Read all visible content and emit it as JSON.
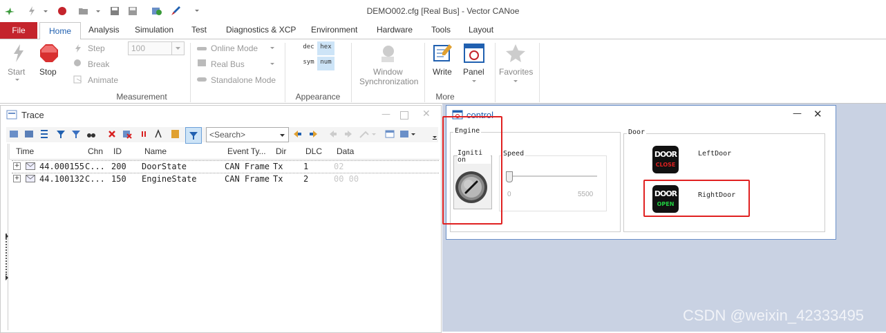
{
  "window": {
    "title": "DEMO002.cfg [Real Bus] - Vector CANoe"
  },
  "tabs": {
    "file": "File",
    "home": "Home",
    "items": [
      "Analysis",
      "Simulation",
      "Test",
      "Diagnostics & XCP",
      "Environment",
      "Hardware",
      "Tools",
      "Layout"
    ]
  },
  "ribbon": {
    "start": "Start",
    "stop": "Stop",
    "step": "Step",
    "break": "Break",
    "animate": "Animate",
    "speed_value": "100",
    "online_mode": "Online Mode",
    "real_bus": "Real Bus",
    "standalone_mode": "Standalone Mode",
    "dec": "dec",
    "hex": "hex",
    "sym": "sym",
    "num": "num",
    "window_sync_1": "Window",
    "window_sync_2": "Synchronization",
    "write": "Write",
    "panel": "Panel",
    "favorites": "Favorites",
    "group_measurement": "Measurement",
    "group_appearance": "Appearance",
    "group_more": "More"
  },
  "trace": {
    "title": "Trace",
    "search_placeholder": "<Search>",
    "columns": {
      "time": "Time",
      "chn": "Chn",
      "id": "ID",
      "name": "Name",
      "event_type": "Event Ty...",
      "dir": "Dir",
      "dlc": "DLC",
      "data": "Data"
    },
    "rows": [
      {
        "time": "44.000155",
        "chn": "C...",
        "id": "200",
        "name": "DoorState",
        "event_type": "CAN Frame",
        "dir": "Tx",
        "dlc": "1",
        "data": "02"
      },
      {
        "time": "44.100132",
        "chn": "C...",
        "id": "150",
        "name": "EngineState",
        "event_type": "CAN Frame",
        "dir": "Tx",
        "dlc": "2",
        "data": "00 00"
      }
    ]
  },
  "control": {
    "title": "control",
    "engine_group": "Engine",
    "ignition_label": "Igniti on",
    "speed_group": "Speed",
    "slider_min": "0",
    "slider_max": "5500",
    "speed_fraction": 0,
    "door_group": "Door",
    "left_door_label": "LeftDoor",
    "right_door_label": "RightDoor",
    "door_word": "DOOR",
    "close_word": "CLOSE",
    "open_word": "OPEN"
  },
  "colors": {
    "file_tab": "#c4242c",
    "accent": "#2060b0",
    "highlight_box": "#e02020",
    "pane_bg": "#c9d2e3"
  },
  "watermark": "CSDN @weixin_42333495"
}
